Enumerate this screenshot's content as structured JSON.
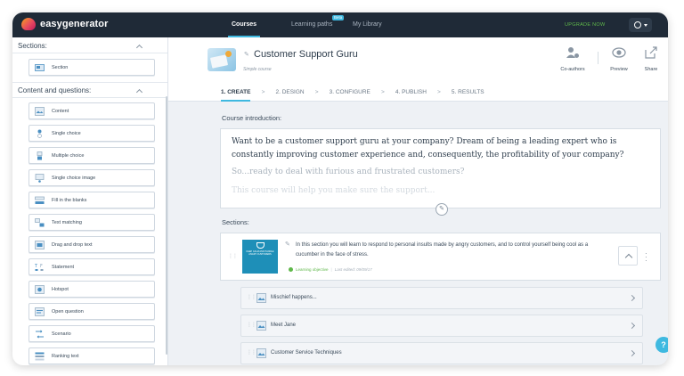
{
  "app": {
    "name": "easygenerator"
  },
  "topnav": {
    "items": [
      {
        "label": "Courses"
      },
      {
        "label": "Learning paths",
        "badge": "Beta"
      },
      {
        "label": "My Library"
      }
    ],
    "upgrade_label": "UPGRADE NOW",
    "user_initial": "O"
  },
  "sidebar": {
    "sections_heading": "Sections:",
    "section_item": "Section",
    "content_heading": "Content and questions:",
    "items": [
      {
        "label": "Content",
        "icon": "content-icon"
      },
      {
        "label": "Single choice",
        "icon": "single-choice-icon"
      },
      {
        "label": "Multiple choice",
        "icon": "multiple-choice-icon"
      },
      {
        "label": "Single choice image",
        "icon": "single-choice-image-icon"
      },
      {
        "label": "Fill in the blanks",
        "icon": "fill-blanks-icon"
      },
      {
        "label": "Text matching",
        "icon": "text-matching-icon"
      },
      {
        "label": "Drag and drop text",
        "icon": "drag-drop-icon"
      },
      {
        "label": "Statement",
        "icon": "statement-icon"
      },
      {
        "label": "Hotspot",
        "icon": "hotspot-icon"
      },
      {
        "label": "Open question",
        "icon": "open-question-icon"
      },
      {
        "label": "Scenario",
        "icon": "scenario-icon"
      },
      {
        "label": "Ranking text",
        "icon": "ranking-icon"
      }
    ]
  },
  "course": {
    "title": "Customer Support Guru",
    "type": "Simple course",
    "actions": [
      {
        "label": "Co-authors"
      },
      {
        "label": "Preview"
      },
      {
        "label": "Share"
      }
    ],
    "steps": [
      "1. CREATE",
      "2. DESIGN",
      "3. CONFIGURE",
      "4. PUBLISH",
      "5. RESULTS"
    ],
    "step_separator": ">"
  },
  "intro": {
    "label": "Course introduction:",
    "paragraph1": "Want to be a customer support guru at your company? Dream of being a leading expert who is constantly improving customer experience and, consequently, the profitability of your company?",
    "paragraph2": "So...ready to deal with furious and frustrated customers?",
    "paragraph3": "This course will help you make sure the support..."
  },
  "sections_area": {
    "label": "Sections:",
    "section": {
      "thumb_text": "KEEP CALM AND HANDLE ANGRY CUSTOMERS",
      "title": "In this section you will learn to respond to personal insults made by angry customers, and to control yourself being cool as a cucumber in the face of stress.",
      "objective_label": "Learning objective",
      "edited": "Last edited: 09/09/17"
    },
    "questions": [
      {
        "label": "Mischief happens..."
      },
      {
        "label": "Meet Jane"
      },
      {
        "label": "Customer Service Techniques"
      }
    ]
  },
  "help": {
    "label": "?"
  }
}
